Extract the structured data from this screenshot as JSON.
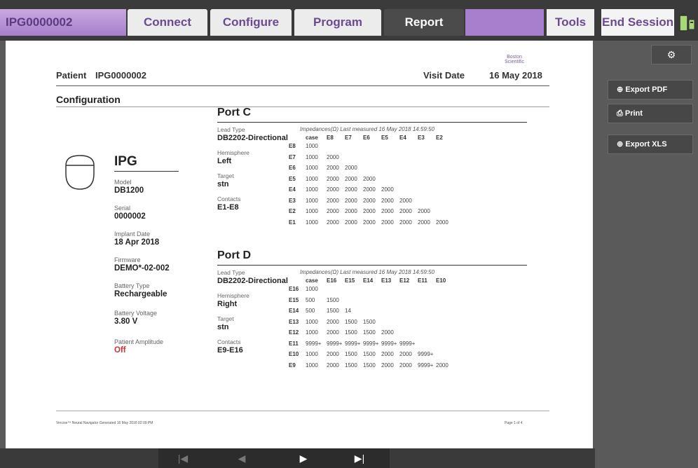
{
  "topbar": {
    "device_id": "IPG0000002",
    "tabs": [
      "Connect",
      "Configure",
      "Program",
      "Report"
    ],
    "tools": "Tools",
    "end_session": "End Session"
  },
  "report": {
    "logo": "Boston Scientific",
    "patient_label": "Patient",
    "patient_value": "IPG0000002",
    "visit_label": "Visit Date",
    "visit_value": "16 May 2018",
    "section": "Configuration",
    "ipg": {
      "title": "IPG",
      "fields": [
        {
          "label": "Model",
          "value": "DB1200"
        },
        {
          "label": "Serial",
          "value": "0000002"
        },
        {
          "label": "Implant Date",
          "value": "18 Apr 2018"
        },
        {
          "label": "Firmware",
          "value": "DEMO*-02-002"
        },
        {
          "label": "Battery Type",
          "value": "Rechargeable"
        },
        {
          "label": "Battery Voltage",
          "value": "3.80 V"
        },
        {
          "label": "Patient Amplitude",
          "value": "Off"
        }
      ]
    },
    "port_c": {
      "title": "Port C",
      "fields": [
        {
          "label": "Lead Type",
          "value": "DB2202-Directional"
        },
        {
          "label": "Hemisphere",
          "value": "Left"
        },
        {
          "label": "Target",
          "value": "stn"
        },
        {
          "label": "Contacts",
          "value": "E1-E8"
        }
      ],
      "imp_header": "Impedances(Ω)   Last measured   16 May 2018 14:59:50",
      "cols": [
        "case",
        "E8",
        "E7",
        "E6",
        "E5",
        "E4",
        "E3",
        "E2"
      ],
      "rows": [
        {
          "label": "E8",
          "cells": [
            "1000"
          ]
        },
        {
          "label": "E7",
          "cells": [
            "1000",
            "2000"
          ]
        },
        {
          "label": "E6",
          "cells": [
            "1000",
            "2000",
            "2000"
          ]
        },
        {
          "label": "E5",
          "cells": [
            "1000",
            "2000",
            "2000",
            "2000"
          ]
        },
        {
          "label": "E4",
          "cells": [
            "1000",
            "2000",
            "2000",
            "2000",
            "2000"
          ]
        },
        {
          "label": "E3",
          "cells": [
            "1000",
            "2000",
            "2000",
            "2000",
            "2000",
            "2000"
          ]
        },
        {
          "label": "E2",
          "cells": [
            "1000",
            "2000",
            "2000",
            "2000",
            "2000",
            "2000",
            "2000"
          ]
        },
        {
          "label": "E1",
          "cells": [
            "1000",
            "2000",
            "2000",
            "2000",
            "2000",
            "2000",
            "2000",
            "2000"
          ]
        }
      ]
    },
    "port_d": {
      "title": "Port D",
      "fields": [
        {
          "label": "Lead Type",
          "value": "DB2202-Directional"
        },
        {
          "label": "Hemisphere",
          "value": "Right"
        },
        {
          "label": "Target",
          "value": "stn"
        },
        {
          "label": "Contacts",
          "value": "E9-E16"
        }
      ],
      "imp_header": "Impedances(Ω)   Last measured   16 May 2018 14:59:50",
      "cols": [
        "case",
        "E16",
        "E15",
        "E14",
        "E13",
        "E12",
        "E11",
        "E10"
      ],
      "rows": [
        {
          "label": "E16",
          "cells": [
            "1000"
          ]
        },
        {
          "label": "E15",
          "cells": [
            "500",
            "1500"
          ]
        },
        {
          "label": "E14",
          "cells": [
            "500",
            "1500",
            "14"
          ]
        },
        {
          "label": "E13",
          "cells": [
            "1000",
            "2000",
            "1500",
            "1500"
          ]
        },
        {
          "label": "E12",
          "cells": [
            "1000",
            "2000",
            "1500",
            "1500",
            "2000"
          ]
        },
        {
          "label": "E11",
          "cells": [
            "9999+",
            "9999+",
            "9999+",
            "9999+",
            "9999+",
            "9999+"
          ]
        },
        {
          "label": "E10",
          "cells": [
            "1000",
            "2000",
            "1500",
            "1500",
            "2000",
            "2000",
            "9999+"
          ]
        },
        {
          "label": "E9",
          "cells": [
            "1000",
            "2000",
            "1500",
            "1500",
            "2000",
            "2000",
            "9999+",
            "2000"
          ]
        }
      ]
    },
    "footer_left": "Vercise™ Neural Navigator   Generated   16 May 2018 02:09 PM",
    "footer_right": "Page 1 of 4"
  },
  "side": {
    "export_pdf": "Export PDF",
    "print": "Print",
    "export_xls": "Export XLS"
  },
  "nav": {
    "first": "|◀",
    "prev": "◀",
    "next": "▶",
    "last": "▶|"
  }
}
